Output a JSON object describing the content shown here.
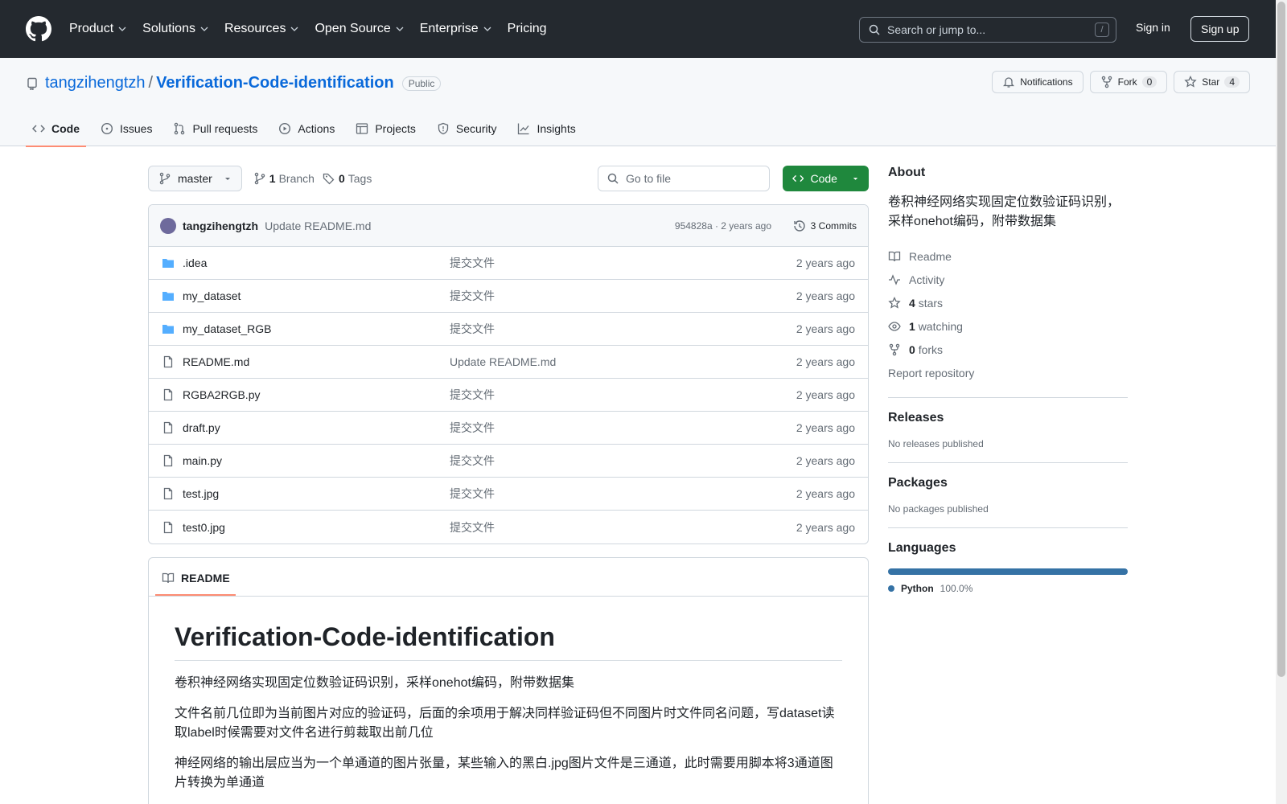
{
  "header": {
    "nav": [
      "Product",
      "Solutions",
      "Resources",
      "Open Source",
      "Enterprise",
      "Pricing"
    ],
    "search_placeholder": "Search or jump to...",
    "search_shortcut": "/",
    "signin": "Sign in",
    "signup": "Sign up"
  },
  "repo": {
    "owner": "tangzihengtzh",
    "separator": "/",
    "name": "Verification-Code-identification",
    "visibility": "Public",
    "notifications": "Notifications",
    "fork_label": "Fork",
    "fork_count": "0",
    "star_label": "Star",
    "star_count": "4"
  },
  "tabs": [
    "Code",
    "Issues",
    "Pull requests",
    "Actions",
    "Projects",
    "Security",
    "Insights"
  ],
  "toolbar": {
    "branch": "master",
    "branch_count": "1",
    "branch_label": "Branch",
    "tag_count": "0",
    "tag_label": "Tags",
    "goto_placeholder": "Go to file",
    "code_button": "Code"
  },
  "commit": {
    "author": "tangzihengtzh",
    "message": "Update README.md",
    "meta": "954828a · 2 years ago",
    "commits": "3 Commits"
  },
  "files": [
    {
      "name": ".idea",
      "type": "folder",
      "message": "提交文件",
      "time": "2 years ago"
    },
    {
      "name": "my_dataset",
      "type": "folder",
      "message": "提交文件",
      "time": "2 years ago"
    },
    {
      "name": "my_dataset_RGB",
      "type": "folder",
      "message": "提交文件",
      "time": "2 years ago"
    },
    {
      "name": "README.md",
      "type": "file",
      "message": "Update README.md",
      "time": "2 years ago"
    },
    {
      "name": "RGBA2RGB.py",
      "type": "file",
      "message": "提交文件",
      "time": "2 years ago"
    },
    {
      "name": "draft.py",
      "type": "file",
      "message": "提交文件",
      "time": "2 years ago"
    },
    {
      "name": "main.py",
      "type": "file",
      "message": "提交文件",
      "time": "2 years ago"
    },
    {
      "name": "test.jpg",
      "type": "file",
      "message": "提交文件",
      "time": "2 years ago"
    },
    {
      "name": "test0.jpg",
      "type": "file",
      "message": "提交文件",
      "time": "2 years ago"
    }
  ],
  "readme": {
    "tab": "README",
    "title": "Verification-Code-identification",
    "paragraphs": [
      "卷积神经网络实现固定位数验证码识别，采样onehot编码，附带数据集",
      "文件名前几位即为当前图片对应的验证码，后面的余项用于解决同样验证码但不同图片时文件同名问题，写dataset读取label时候需要对文件名进行剪裁取出前几位",
      "神经网络的输出层应当为一个单通道的图片张量，某些输入的黑白.jpg图片文件是三通道，此时需要用脚本将3通道图片转换为单通道"
    ]
  },
  "about": {
    "title": "About",
    "description": "卷积神经网络实现固定位数验证码识别，采样onehot编码，附带数据集",
    "readme": "Readme",
    "activity": "Activity",
    "stars_count": "4",
    "stars_label": "stars",
    "watching_count": "1",
    "watching_label": "watching",
    "forks_count": "0",
    "forks_label": "forks",
    "report": "Report repository"
  },
  "releases": {
    "title": "Releases",
    "empty": "No releases published"
  },
  "packages": {
    "title": "Packages",
    "empty": "No packages published"
  },
  "languages": {
    "title": "Languages",
    "name": "Python",
    "percent": "100.0%",
    "color": "#3572A5"
  }
}
